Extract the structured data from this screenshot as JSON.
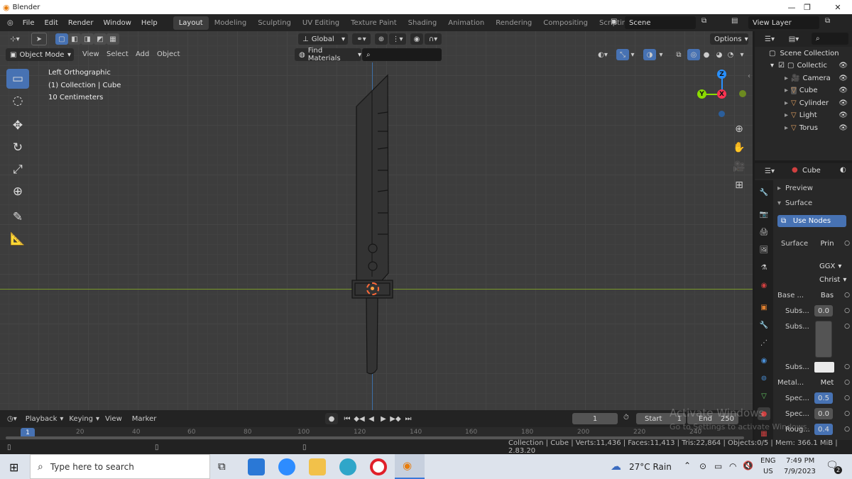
{
  "window": {
    "title": "Blender",
    "minimize": "—",
    "maximize": "❐",
    "close": "✕"
  },
  "menu": [
    "File",
    "Edit",
    "Render",
    "Window",
    "Help"
  ],
  "workspaces": [
    "Layout",
    "Modeling",
    "Sculpting",
    "UV Editing",
    "Texture Paint",
    "Shading",
    "Animation",
    "Rendering",
    "Compositing",
    "Scripting"
  ],
  "active_workspace": "Layout",
  "scene": {
    "name": "Scene",
    "view_layer": "View Layer"
  },
  "toolbar": {
    "transform_orientation": "Global",
    "options": "Options"
  },
  "viewport_header": {
    "mode": "Object Mode",
    "view": "View",
    "select": "Select",
    "add": "Add",
    "object": "Object",
    "find_materials": "Find Materials"
  },
  "viewport_info": {
    "line1": "Left Orthographic",
    "line2": "(1) Collection | Cube",
    "line3": "10 Centimeters"
  },
  "gizmo": {
    "z": "Z",
    "y": "Y",
    "x": "X"
  },
  "outliner": {
    "root": "Scene Collection",
    "collection": "Collectic",
    "items": [
      "Camera",
      "Cube",
      "Cylinder",
      "Light",
      "Torus"
    ]
  },
  "properties": {
    "object": "Cube",
    "preview": "Preview",
    "surface": "Surface",
    "use_nodes": "Use Nodes",
    "surface_label": "Surface",
    "surface_value": "Prin",
    "ggx": "GGX",
    "christ": "Christ",
    "base_label": "Base ...",
    "base_value": "Bas",
    "subs1_label": "Subs...",
    "subs1_value": "0.0",
    "subs2_label": "Subs...",
    "subs3_label": "Subs...",
    "metal_label": "Metal...",
    "metal_value": "Met",
    "spec1_label": "Spec...",
    "spec1_value": "0.5",
    "spec2_label": "Spec...",
    "spec2_value": "0.0",
    "rough_label": "Roug...",
    "rough_value": "0.4"
  },
  "timeline": {
    "playback": "Playback",
    "keying": "Keying",
    "view": "View",
    "marker": "Marker",
    "current_frame": "1",
    "start_label": "Start",
    "start": "1",
    "end_label": "End",
    "end": "250",
    "ruler": [
      "1",
      "20",
      "40",
      "60",
      "80",
      "100",
      "120",
      "140",
      "160",
      "180",
      "200",
      "220",
      "240"
    ]
  },
  "watermark": {
    "line1": "Activate Windows",
    "line2": "Go to Settings to activate Windows."
  },
  "status": {
    "text": "Collection | Cube | Verts:11,436 | Faces:11,413 | Tris:22,864 | Objects:0/5 | Mem: 366.1 MiB | 2.83.20"
  },
  "taskbar": {
    "search_placeholder": "Type here to search",
    "weather": "27°C  Rain",
    "lang1": "ENG",
    "lang2": "US",
    "time": "7:49 PM",
    "date": "7/9/2023",
    "notifications": "2"
  },
  "colors": {
    "accent": "#4772b3",
    "x_axis": "#ff3352",
    "y_axis": "#8bdc00",
    "z_axis": "#2890ff"
  }
}
